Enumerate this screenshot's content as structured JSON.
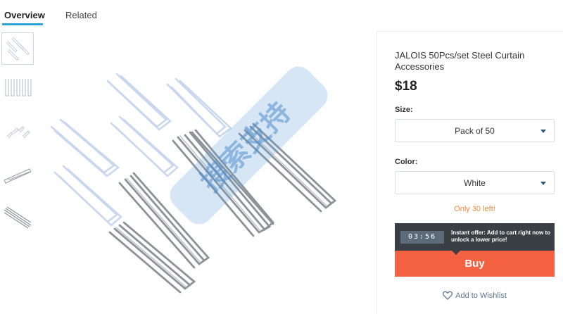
{
  "tabs": [
    {
      "label": "Overview",
      "active": true
    },
    {
      "label": "Related",
      "active": false
    }
  ],
  "product": {
    "title": "JALOIS 50Pcs/set Steel Curtain Accessories",
    "price": "$18"
  },
  "size": {
    "label": "Size:",
    "selected": "Pack of 50"
  },
  "color": {
    "label": "Color:",
    "selected": "White"
  },
  "stock_text": "Only 30 left!",
  "offer": {
    "timer": "03:56",
    "text": "Instant offer: Add to cart right now to unlock a lower price!"
  },
  "buy_label": "Buy",
  "wishlist_label": "Add to Wishlist",
  "watermark_text": "搜索支持",
  "colors": {
    "accent": "#2aa3d9",
    "buy": "#f36141",
    "offer_bg": "#3a3f45",
    "stock": "#f3893f"
  }
}
